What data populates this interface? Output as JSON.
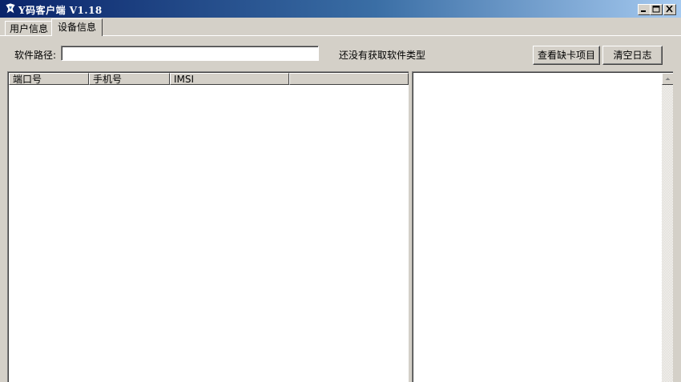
{
  "window": {
    "title": "Y码客户端 V1.18",
    "buttons": [
      "minimize-icon",
      "maximize-icon",
      "close-icon"
    ]
  },
  "tabs": [
    {
      "label": "用户信息",
      "active": false
    },
    {
      "label": "设备信息",
      "active": true
    }
  ],
  "toolbar": {
    "path_label": "软件路径:",
    "path_value": "",
    "status_text": "还没有获取软件类型",
    "missing_card_button": "查看缺卡项目",
    "clear_log_button": "清空日志"
  },
  "device_list": {
    "columns": [
      "端口号",
      "手机号",
      "IMSI",
      ""
    ],
    "rows": []
  },
  "log": {
    "lines": []
  },
  "colors": {
    "titlebar_start": "#0a246a",
    "titlebar_end": "#a6caf0",
    "face": "#d4d0c8"
  }
}
